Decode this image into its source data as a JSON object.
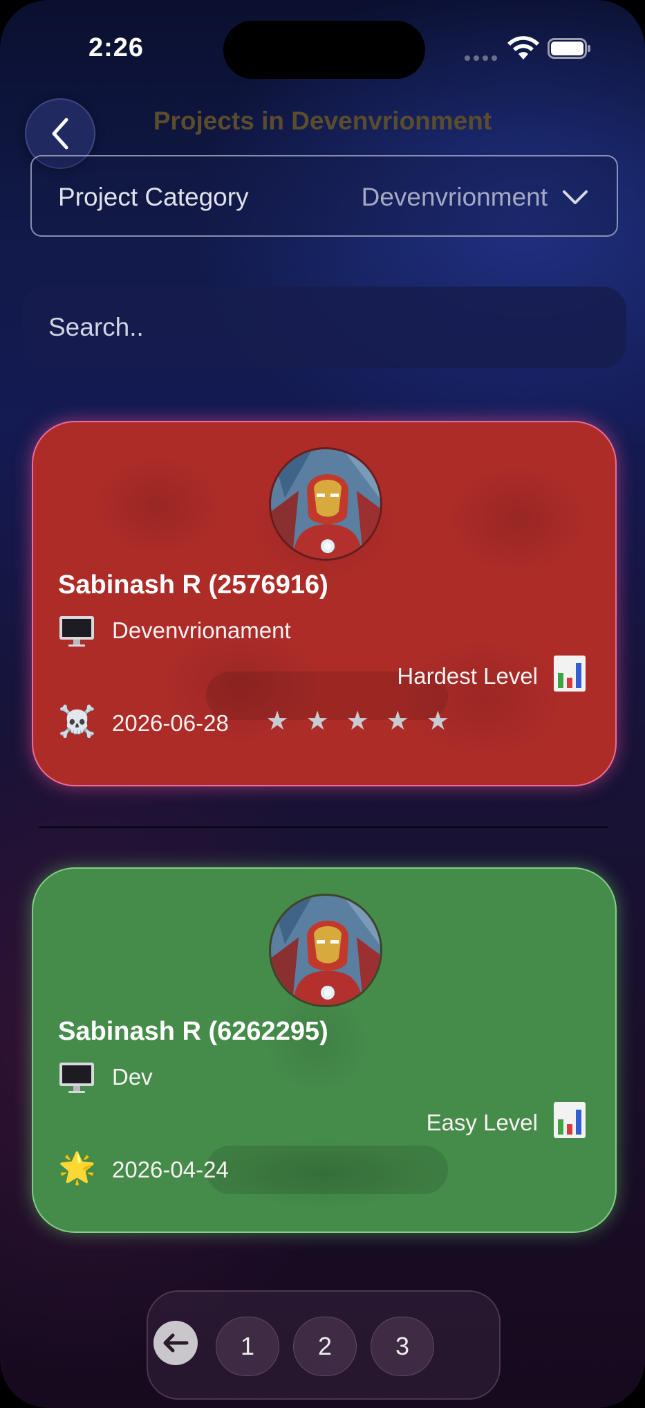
{
  "status_bar": {
    "time": "2:26"
  },
  "header": {
    "title": "Projects in Devenvrionment"
  },
  "category": {
    "label": "Project Category",
    "value": "Devenvrionment"
  },
  "search": {
    "placeholder": "Search.."
  },
  "cards": [
    {
      "name": "Sabinash R (2576916)",
      "tech_icon": "desktop-computer-icon",
      "tech": "Devenvrionament",
      "level": "Hardest Level",
      "level_icon": "bar-chart-icon",
      "status_icon": "skull-crossbones-icon",
      "status_emoji": "☠️",
      "date": "2026-06-28",
      "stars": 5,
      "star_glyph": "★",
      "color": "#ad2c28"
    },
    {
      "name": "Sabinash R (6262295)",
      "tech_icon": "desktop-computer-icon",
      "tech": "Dev",
      "level": "Easy Level",
      "level_icon": "bar-chart-icon",
      "status_icon": "glowing-star-icon",
      "status_emoji": "🌟",
      "date": "2026-04-24",
      "color": "#458b4a"
    }
  ],
  "pagination": {
    "pages": [
      "1",
      "2",
      "3"
    ]
  },
  "colors": {
    "title": "#5b4d2c",
    "background_top": "#0b1030",
    "background_bottom": "#160a1e"
  }
}
